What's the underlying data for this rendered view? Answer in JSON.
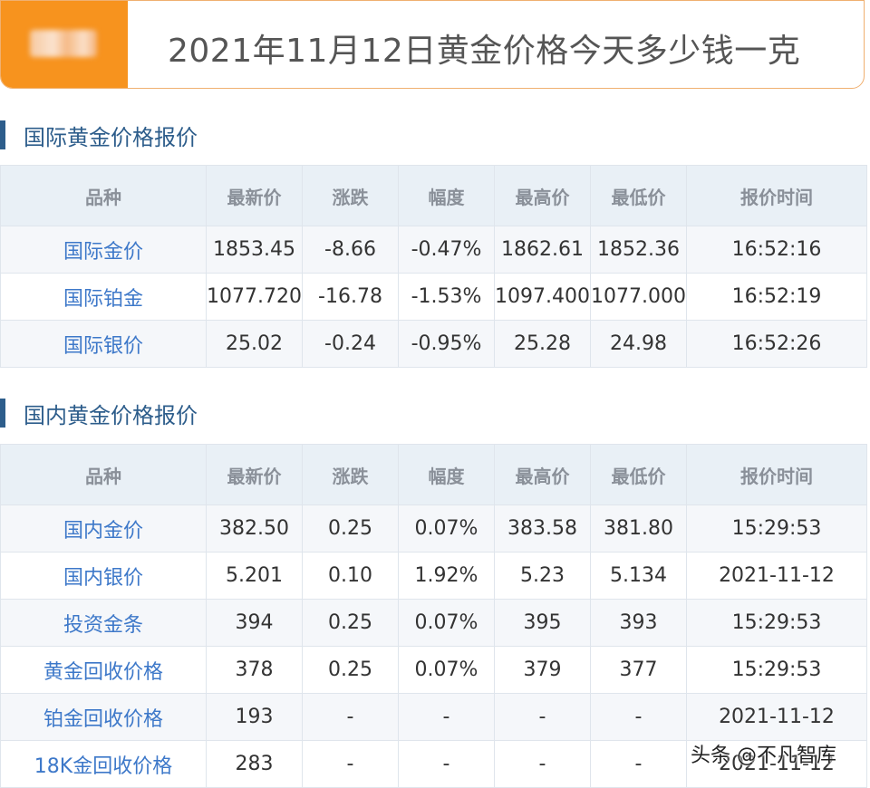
{
  "header": {
    "title": "2021年11月12日黄金价格今天多少钱一克"
  },
  "columns": [
    "品种",
    "最新价",
    "涨跌",
    "幅度",
    "最高价",
    "最低价",
    "报价时间"
  ],
  "international": {
    "heading": "国际黄金价格报价",
    "rows": [
      [
        "国际金价",
        "1853.45",
        "-8.66",
        "-0.47%",
        "1862.61",
        "1852.36",
        "16:52:16"
      ],
      [
        "国际铂金",
        "1077.720",
        "-16.78",
        "-1.53%",
        "1097.400",
        "1077.000",
        "16:52:19"
      ],
      [
        "国际银价",
        "25.02",
        "-0.24",
        "-0.95%",
        "25.28",
        "24.98",
        "16:52:26"
      ]
    ]
  },
  "domestic": {
    "heading": "国内黄金价格报价",
    "rows": [
      [
        "国内金价",
        "382.50",
        "0.25",
        "0.07%",
        "383.58",
        "381.80",
        "15:29:53"
      ],
      [
        "国内银价",
        "5.201",
        "0.10",
        "1.92%",
        "5.23",
        "5.134",
        "2021-11-12"
      ],
      [
        "投资金条",
        "394",
        "0.25",
        "0.07%",
        "395",
        "393",
        "15:29:53"
      ],
      [
        "黄金回收价格",
        "378",
        "0.25",
        "0.07%",
        "379",
        "377",
        "15:29:53"
      ],
      [
        "铂金回收价格",
        "193",
        "-",
        "-",
        "-",
        "-",
        "2021-11-12"
      ],
      [
        "18K金回收价格",
        "283",
        "-",
        "-",
        "-",
        "-",
        "2021-11-12"
      ]
    ]
  },
  "watermark": "头条 @不凡智库",
  "colors": {
    "accent_orange": "#f7931e",
    "heading_blue": "#2d5d8b",
    "link_blue": "#3d78c9",
    "header_row_bg": "#e9f0f6"
  }
}
